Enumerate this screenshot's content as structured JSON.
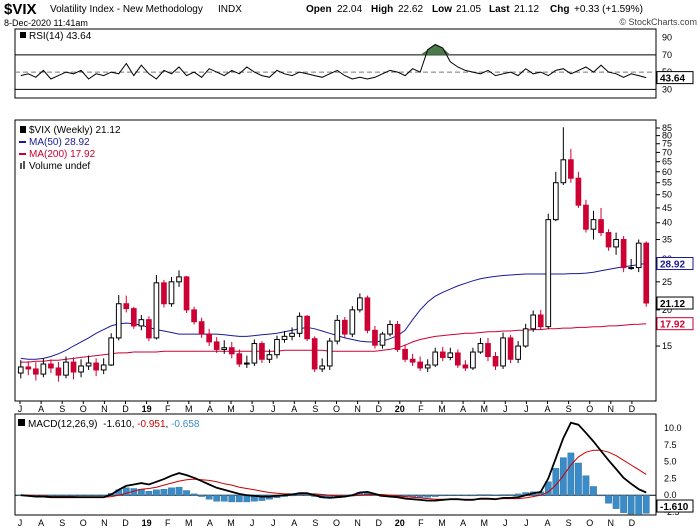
{
  "header": {
    "symbol": "$VIX",
    "name": "Volatility Index - New Methodology",
    "exchange": "INDX",
    "date": "8-Dec-2020 11:41am",
    "open_label": "Open",
    "open": "22.04",
    "high_label": "High",
    "high": "22.62",
    "low_label": "Low",
    "low": "21.05",
    "last_label": "Last",
    "last": "21.12",
    "chg_label": "Chg",
    "chg": "+0.33 (+1.59%)",
    "watermark": "© StockCharts.com"
  },
  "colors": {
    "up": "#000000",
    "down": "#cc0033",
    "ma50": "#1a1a99",
    "ma200": "#cc0033",
    "rsi": "#000000",
    "rsi_fill": "#4a7a4a",
    "macd": "#000000",
    "signal": "#cc0000",
    "hist": "#3a8cc8",
    "grid": "#cccccc"
  },
  "chart_data": [
    {
      "type": "line",
      "panel": "RSI",
      "label": "RSI(14) 43.64",
      "current": 43.64,
      "ylim": [
        20,
        100
      ],
      "y_ticks": [
        30,
        50,
        70,
        90
      ],
      "levels": [
        30,
        70
      ],
      "values": [
        46,
        48,
        44,
        52,
        42,
        46,
        50,
        48,
        52,
        42,
        48,
        46,
        50,
        48,
        60,
        46,
        58,
        48,
        42,
        52,
        48,
        56,
        46,
        50,
        44,
        54,
        50,
        46,
        52,
        48,
        56,
        50,
        46,
        44,
        52,
        48,
        46,
        50,
        48,
        46,
        44,
        48,
        52,
        46,
        42,
        44,
        42,
        44,
        48,
        52,
        50,
        46,
        54,
        50,
        76,
        82,
        78,
        62,
        56,
        52,
        50,
        48,
        52,
        46,
        48,
        50,
        46,
        54,
        48,
        50,
        46,
        52,
        54,
        48,
        52,
        56,
        50,
        58,
        50,
        48,
        44,
        48,
        46,
        43.64
      ]
    },
    {
      "type": "candlestick",
      "panel": "Price",
      "scale": "log",
      "title": "$VIX (Weekly) 21.12",
      "legend": [
        "$VIX (Weekly) 21.12",
        "MA(50) 28.92",
        "MA(200) 17.92",
        "Volume undef"
      ],
      "ylim": [
        10,
        85
      ],
      "y_ticks": [
        15,
        20,
        25,
        30,
        35,
        40,
        45,
        50,
        55,
        60,
        65,
        70,
        75,
        80,
        85
      ],
      "x_labels": [
        "J",
        "A",
        "S",
        "O",
        "N",
        "D",
        "19",
        "F",
        "M",
        "A",
        "M",
        "J",
        "J",
        "A",
        "S",
        "O",
        "N",
        "D",
        "20",
        "F",
        "M",
        "A",
        "M",
        "J",
        "J",
        "A",
        "S",
        "O",
        "N",
        "D"
      ],
      "last_label": "21.12",
      "ma50": {
        "name": "MA(50)",
        "value": 28.92,
        "values": [
          13.6,
          13.5,
          13.5,
          13.6,
          13.8,
          14.1,
          14.5,
          15.0,
          15.5,
          16.0,
          16.6,
          17.1,
          17.6,
          17.9,
          18.0,
          17.9,
          17.7,
          17.4,
          17.1,
          16.9,
          16.7,
          16.5,
          16.5,
          16.5,
          16.5,
          16.5,
          16.5,
          16.4,
          16.3,
          16.2,
          16.2,
          16.3,
          16.4,
          16.5,
          16.6,
          16.8,
          17.0,
          17.2,
          17.4,
          17.2,
          16.9,
          16.6,
          16.3,
          16.0,
          15.8,
          15.6,
          15.5,
          15.5,
          15.6,
          15.9,
          16.3,
          17.0,
          18.5,
          20.0,
          21.3,
          22.3,
          23.0,
          23.6,
          24.2,
          24.7,
          25.2,
          25.6,
          25.9,
          26.1,
          26.3,
          26.4,
          26.5,
          26.6,
          26.6,
          26.6,
          26.6,
          26.6,
          26.6,
          26.7,
          26.7,
          26.8,
          27.0,
          27.3,
          27.6,
          27.9,
          28.2,
          28.4,
          28.7,
          28.92
        ]
      },
      "ma200": {
        "name": "MA(200)",
        "value": 17.92,
        "values": [
          13.2,
          13.2,
          13.3,
          13.3,
          13.4,
          13.4,
          13.5,
          13.6,
          13.7,
          13.8,
          13.9,
          14.0,
          14.1,
          14.2,
          14.2,
          14.3,
          14.3,
          14.3,
          14.3,
          14.4,
          14.4,
          14.4,
          14.4,
          14.4,
          14.4,
          14.4,
          14.4,
          14.4,
          14.4,
          14.4,
          14.4,
          14.4,
          14.4,
          14.4,
          14.4,
          14.5,
          14.5,
          14.5,
          14.5,
          14.5,
          14.5,
          14.4,
          14.4,
          14.4,
          14.4,
          14.4,
          14.4,
          14.4,
          14.5,
          14.6,
          14.8,
          15.1,
          15.5,
          15.8,
          16.0,
          16.2,
          16.3,
          16.4,
          16.5,
          16.6,
          16.6,
          16.7,
          16.8,
          16.8,
          16.9,
          16.9,
          17.0,
          17.0,
          17.1,
          17.1,
          17.2,
          17.2,
          17.3,
          17.3,
          17.4,
          17.4,
          17.5,
          17.5,
          17.6,
          17.6,
          17.7,
          17.8,
          17.85,
          17.92
        ]
      },
      "candles": {
        "o": [
          12.1,
          12.7,
          12.5,
          12.0,
          13.0,
          12.6,
          11.9,
          13.2,
          12.2,
          12.8,
          13.1,
          12.4,
          12.9,
          16.0,
          21.0,
          20.2,
          17.6,
          18.5,
          16.0,
          24.8,
          21.0,
          25.0,
          26.0,
          20.0,
          18.2,
          16.5,
          15.5,
          14.6,
          14.8,
          14.1,
          13.0,
          13.1,
          15.3,
          13.5,
          14.0,
          15.8,
          16.2,
          16.6,
          19.0,
          15.9,
          12.5,
          12.8,
          15.6,
          18.4,
          16.5,
          20.0,
          22.0,
          17.0,
          15.1,
          16.5,
          17.8,
          14.6,
          13.5,
          13.2,
          12.6,
          12.9,
          14.3,
          13.7,
          14.2,
          12.9,
          12.6,
          14.3,
          15.3,
          13.8,
          12.8,
          16.0,
          13.5,
          15.0,
          17.2,
          19.2,
          17.5,
          41.0,
          55.0,
          66.0,
          57.0,
          46.0,
          38.0,
          41.0,
          37.0,
          33.0,
          35.0,
          28.0,
          28.0,
          34.0
        ],
        "c": [
          12.7,
          12.5,
          12.0,
          13.0,
          12.6,
          11.9,
          13.2,
          12.2,
          12.8,
          13.1,
          12.4,
          12.9,
          16.0,
          21.0,
          20.2,
          17.6,
          18.5,
          16.0,
          24.8,
          21.0,
          25.0,
          26.0,
          20.0,
          18.2,
          16.5,
          15.5,
          14.6,
          14.8,
          14.1,
          13.0,
          13.1,
          15.3,
          13.5,
          14.0,
          15.8,
          16.2,
          16.6,
          19.0,
          15.9,
          12.5,
          12.8,
          15.6,
          18.4,
          16.5,
          20.0,
          22.0,
          17.0,
          15.1,
          16.5,
          17.8,
          14.6,
          13.5,
          13.2,
          12.6,
          12.9,
          14.3,
          13.7,
          14.2,
          12.9,
          12.6,
          14.3,
          15.3,
          13.8,
          12.8,
          16.0,
          13.5,
          15.0,
          17.2,
          19.2,
          17.5,
          41.0,
          55.0,
          66.0,
          57.0,
          46.0,
          38.0,
          41.0,
          37.0,
          33.0,
          35.0,
          28.0,
          28.0,
          34.0,
          21.12
        ],
        "h": [
          13.4,
          13.3,
          13.2,
          13.6,
          13.5,
          13.2,
          13.8,
          13.7,
          13.5,
          13.9,
          13.6,
          13.6,
          16.6,
          22.5,
          22.4,
          20.5,
          19.2,
          19.0,
          26.4,
          25.4,
          26.0,
          27.4,
          26.2,
          20.5,
          18.8,
          17.2,
          16.1,
          15.7,
          15.5,
          14.6,
          13.9,
          15.8,
          15.6,
          14.6,
          16.3,
          16.9,
          17.4,
          19.6,
          19.2,
          16.2,
          13.6,
          16.0,
          19.2,
          18.9,
          20.6,
          22.8,
          22.4,
          17.6,
          16.8,
          18.4,
          18.3,
          15.2,
          14.1,
          13.8,
          13.5,
          14.8,
          14.9,
          14.8,
          14.6,
          13.4,
          14.8,
          16.0,
          16.0,
          14.3,
          16.7,
          16.4,
          15.6,
          17.9,
          19.9,
          20.0,
          43.0,
          60.0,
          85.5,
          72.0,
          60.0,
          48.0,
          44.0,
          45.0,
          38.0,
          37.0,
          36.0,
          30.0,
          35.0,
          34.5
        ],
        "l": [
          11.6,
          11.9,
          11.4,
          11.7,
          12.1,
          11.3,
          11.6,
          11.5,
          11.7,
          12.4,
          11.8,
          12.0,
          12.8,
          15.7,
          19.6,
          17.2,
          17.0,
          15.6,
          15.8,
          20.4,
          20.5,
          24.0,
          19.5,
          17.8,
          16.0,
          15.0,
          14.2,
          14.1,
          13.6,
          12.7,
          12.6,
          12.8,
          13.1,
          13.1,
          13.6,
          15.4,
          15.7,
          16.1,
          15.6,
          12.2,
          12.2,
          12.4,
          15.2,
          16.0,
          16.1,
          19.6,
          16.6,
          14.7,
          14.7,
          16.2,
          14.3,
          13.2,
          12.8,
          12.3,
          12.2,
          12.7,
          13.3,
          13.4,
          12.6,
          12.3,
          12.4,
          14.1,
          13.3,
          12.4,
          12.5,
          13.1,
          13.1,
          14.8,
          16.8,
          17.1,
          17.2,
          40.5,
          54.0,
          55.0,
          45.0,
          37.0,
          35.0,
          36.0,
          32.0,
          31.0,
          27.0,
          27.5,
          27.0,
          20.5
        ]
      }
    },
    {
      "type": "line",
      "panel": "MACD",
      "label_prefix": "MACD(12,26,9)",
      "macd_value": "-1.610",
      "signal_value": "-0.951",
      "hist_value": "-0.658",
      "last_label": "-1.610",
      "ylim": [
        -2.5,
        11.5
      ],
      "y_ticks": [
        -2.5,
        0.0,
        2.5,
        5.0,
        7.5,
        10.0
      ],
      "x_labels": [
        "J",
        "A",
        "S",
        "O",
        "N",
        "D",
        "19",
        "F",
        "M",
        "A",
        "M",
        "J",
        "J",
        "A",
        "S",
        "O",
        "N",
        "D",
        "20",
        "F",
        "M",
        "A",
        "M",
        "J",
        "J",
        "A",
        "S",
        "O",
        "N",
        "D"
      ],
      "macd": [
        0.0,
        -0.1,
        -0.2,
        -0.2,
        -0.3,
        -0.3,
        -0.3,
        -0.3,
        -0.3,
        -0.3,
        -0.3,
        -0.3,
        0.1,
        0.8,
        1.4,
        1.6,
        1.8,
        1.6,
        2.0,
        2.4,
        2.9,
        3.3,
        3.0,
        2.6,
        2.1,
        1.6,
        1.1,
        0.8,
        0.5,
        0.2,
        0.0,
        -0.1,
        -0.2,
        -0.2,
        -0.1,
        0.0,
        0.1,
        0.3,
        0.3,
        0.0,
        -0.3,
        -0.4,
        -0.3,
        -0.2,
        0.0,
        0.4,
        0.5,
        0.2,
        -0.1,
        -0.2,
        -0.3,
        -0.5,
        -0.6,
        -0.7,
        -0.8,
        -0.8,
        -0.7,
        -0.6,
        -0.6,
        -0.7,
        -0.7,
        -0.5,
        -0.5,
        -0.6,
        -0.4,
        -0.4,
        -0.3,
        0.0,
        0.3,
        0.5,
        2.5,
        5.5,
        8.5,
        10.8,
        10.5,
        9.3,
        8.0,
        6.6,
        5.2,
        3.9,
        2.6,
        1.7,
        0.9,
        0.4
      ],
      "signal": [
        0.0,
        0.0,
        -0.1,
        -0.1,
        -0.2,
        -0.2,
        -0.2,
        -0.2,
        -0.3,
        -0.3,
        -0.3,
        -0.3,
        -0.2,
        0.0,
        0.3,
        0.6,
        0.9,
        1.0,
        1.2,
        1.5,
        1.8,
        2.1,
        2.3,
        2.4,
        2.3,
        2.2,
        2.0,
        1.7,
        1.5,
        1.2,
        1.0,
        0.8,
        0.6,
        0.4,
        0.3,
        0.2,
        0.2,
        0.2,
        0.2,
        0.2,
        0.1,
        0.0,
        -0.1,
        -0.1,
        -0.1,
        0.0,
        0.1,
        0.1,
        0.1,
        0.0,
        -0.1,
        -0.2,
        -0.3,
        -0.4,
        -0.5,
        -0.6,
        -0.6,
        -0.6,
        -0.6,
        -0.6,
        -0.6,
        -0.6,
        -0.6,
        -0.6,
        -0.5,
        -0.5,
        -0.5,
        -0.4,
        -0.2,
        0.0,
        0.5,
        1.5,
        2.9,
        4.5,
        5.7,
        6.4,
        6.7,
        6.7,
        6.4,
        5.9,
        5.2,
        4.5,
        3.8,
        3.1
      ]
    }
  ]
}
